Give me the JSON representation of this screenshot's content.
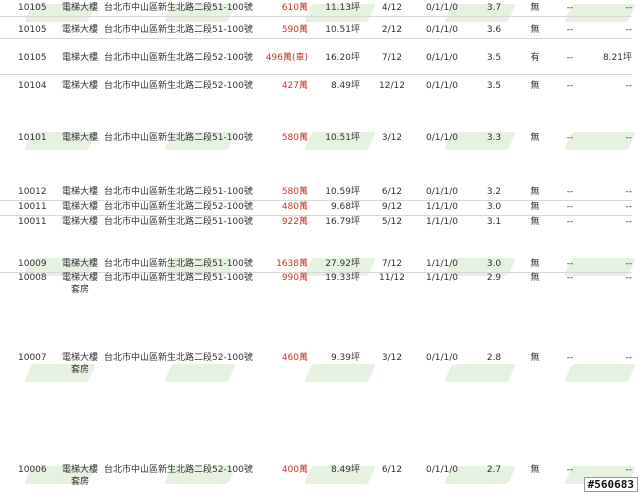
{
  "table": {
    "rows": [
      {
        "date": "10105",
        "type": "電梯大樓",
        "type2": "",
        "addr": "台北市中山區新生北路二段51-100號",
        "price": "610萬",
        "area": "11.13坪",
        "floor": "4/12",
        "rooms": "0/1/1/0",
        "grade": "3.7",
        "parking": "無",
        "extra1": "--",
        "extra2": "--"
      },
      {
        "date": "10105",
        "type": "電梯大樓",
        "type2": "",
        "addr": "台北市中山區新生北路二段51-100號",
        "price": "590萬",
        "area": "10.51坪",
        "floor": "2/12",
        "rooms": "0/1/1/0",
        "grade": "3.6",
        "parking": "無",
        "extra1": "--",
        "extra2": "--"
      },
      {
        "date": "10105",
        "type": "電梯大樓",
        "type2": "",
        "addr": "台北市中山區新生北路二段52-100號",
        "price": "496萬(車)",
        "area": "16.20坪",
        "floor": "7/12",
        "rooms": "0/1/1/0",
        "grade": "3.5",
        "parking": "有",
        "extra1": "--",
        "extra2": "8.21坪"
      },
      {
        "date": "10104",
        "type": "電梯大樓",
        "type2": "",
        "addr": "台北市中山區新生北路二段52-100號",
        "price": "427萬",
        "area": "8.49坪",
        "floor": "12/12",
        "rooms": "0/1/1/0",
        "grade": "3.5",
        "parking": "無",
        "extra1": "--",
        "extra2": "--"
      },
      {
        "date": "10101",
        "type": "電梯大樓",
        "type2": "",
        "addr": "台北市中山區新生北路二段51-100號",
        "price": "580萬",
        "area": "10.51坪",
        "floor": "3/12",
        "rooms": "0/1/1/0",
        "grade": "3.3",
        "parking": "無",
        "extra1": "--",
        "extra2": "--"
      },
      {
        "date": "10012",
        "type": "電梯大樓",
        "type2": "",
        "addr": "台北市中山區新生北路二段51-100號",
        "price": "580萬",
        "area": "10.59坪",
        "floor": "6/12",
        "rooms": "0/1/1/0",
        "grade": "3.2",
        "parking": "無",
        "extra1": "--",
        "extra2": "--"
      },
      {
        "date": "10011",
        "type": "電梯大樓",
        "type2": "",
        "addr": "台北市中山區新生北路二段52-100號",
        "price": "480萬",
        "area": "9.68坪",
        "floor": "9/12",
        "rooms": "1/1/1/0",
        "grade": "3.0",
        "parking": "無",
        "extra1": "--",
        "extra2": "--"
      },
      {
        "date": "10011",
        "type": "電梯大樓",
        "type2": "",
        "addr": "台北市中山區新生北路二段51-100號",
        "price": "922萬",
        "area": "16.79坪",
        "floor": "5/12",
        "rooms": "1/1/1/0",
        "grade": "3.1",
        "parking": "無",
        "extra1": "--",
        "extra2": "--"
      },
      {
        "date": "10009",
        "type": "電梯大樓",
        "type2": "",
        "addr": "台北市中山區新生北路二段51-100號",
        "price": "1638萬",
        "area": "27.92坪",
        "floor": "7/12",
        "rooms": "1/1/1/0",
        "grade": "3.0",
        "parking": "無",
        "extra1": "--",
        "extra2": "--"
      },
      {
        "date": "10008",
        "type": "電梯大樓",
        "type2": "套房",
        "addr": "台北市中山區新生北路二段51-100號",
        "price": "990萬",
        "area": "19.33坪",
        "floor": "11/12",
        "rooms": "1/1/1/0",
        "grade": "2.9",
        "parking": "無",
        "extra1": "--",
        "extra2": "--"
      },
      {
        "date": "10007",
        "type": "電梯大樓",
        "type2": "套房",
        "addr": "台北市中山區新生北路二段52-100號",
        "price": "460萬",
        "area": "9.39坪",
        "floor": "3/12",
        "rooms": "0/1/1/0",
        "grade": "2.8",
        "parking": "無",
        "extra1": "--",
        "extra2": "--"
      },
      {
        "date": "10006",
        "type": "電梯大樓",
        "type2": "套房",
        "addr": "台北市中山區新生北路二段52-100號",
        "price": "400萬",
        "area": "8.49坪",
        "floor": "6/12",
        "rooms": "0/1/1/0",
        "grade": "2.7",
        "parking": "無",
        "extra1": "--",
        "extra2": "--"
      }
    ]
  },
  "watermark_id": "#560683",
  "colors": {
    "price": "#c0392b",
    "watermark": "#cfe6c4",
    "text": "#333333"
  }
}
